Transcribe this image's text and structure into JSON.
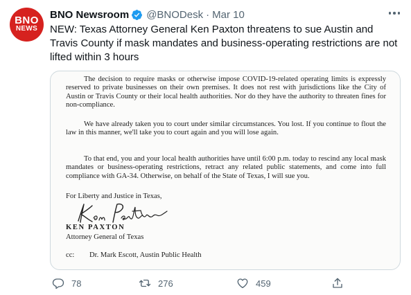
{
  "account": {
    "display_name": "BNO Newsroom",
    "handle": "@BNODesk",
    "separator": "·",
    "date": "Mar 10",
    "avatar_top": "BNO",
    "avatar_bottom": "NEWS",
    "verified": true
  },
  "tweet": {
    "text": "NEW: Texas Attorney General Ken Paxton threatens to sue Austin and Travis County if mask mandates and business-operating restrictions are not lifted within 3 hours"
  },
  "letter": {
    "paragraph_1": "The decision to require masks or otherwise impose COVID-19-related operating limits is expressly reserved to private businesses on their own premises. It does not rest with jurisdictions like the City of Austin or Travis County or their local health authorities. Nor do they have the authority to threaten fines for non-compliance.",
    "paragraph_2": "We have already taken you to court under similar circumstances. You lost. If you continue to flout the law in this manner, we'll take you to court again and you will lose again.",
    "paragraph_3": "To that end, you and your local health authorities have until 6:00 p.m. today to rescind any local mask mandates or business-operating restrictions, retract any related public statements, and come into full compliance with GA-34. Otherwise, on behalf of the State of Texas, I will sue you.",
    "closing": "For Liberty and Justice in Texas,",
    "signature_script": "Ken Paxton",
    "signer_name": "KEN PAXTON",
    "signer_title": "Attorney General of Texas",
    "cc_label": "cc:",
    "cc_value": "Dr. Mark Escott, Austin Public Health"
  },
  "actions": {
    "reply_count": "78",
    "retweet_count": "276",
    "like_count": "459"
  },
  "colors": {
    "text_primary": "#0f1419",
    "text_secondary": "#536471",
    "verified_blue": "#1d9bf0",
    "avatar_red": "#d6221f",
    "media_border": "#cfd9de"
  },
  "icons": [
    "verified-badge-icon",
    "more-icon",
    "reply-icon",
    "retweet-icon",
    "like-icon",
    "share-icon"
  ]
}
